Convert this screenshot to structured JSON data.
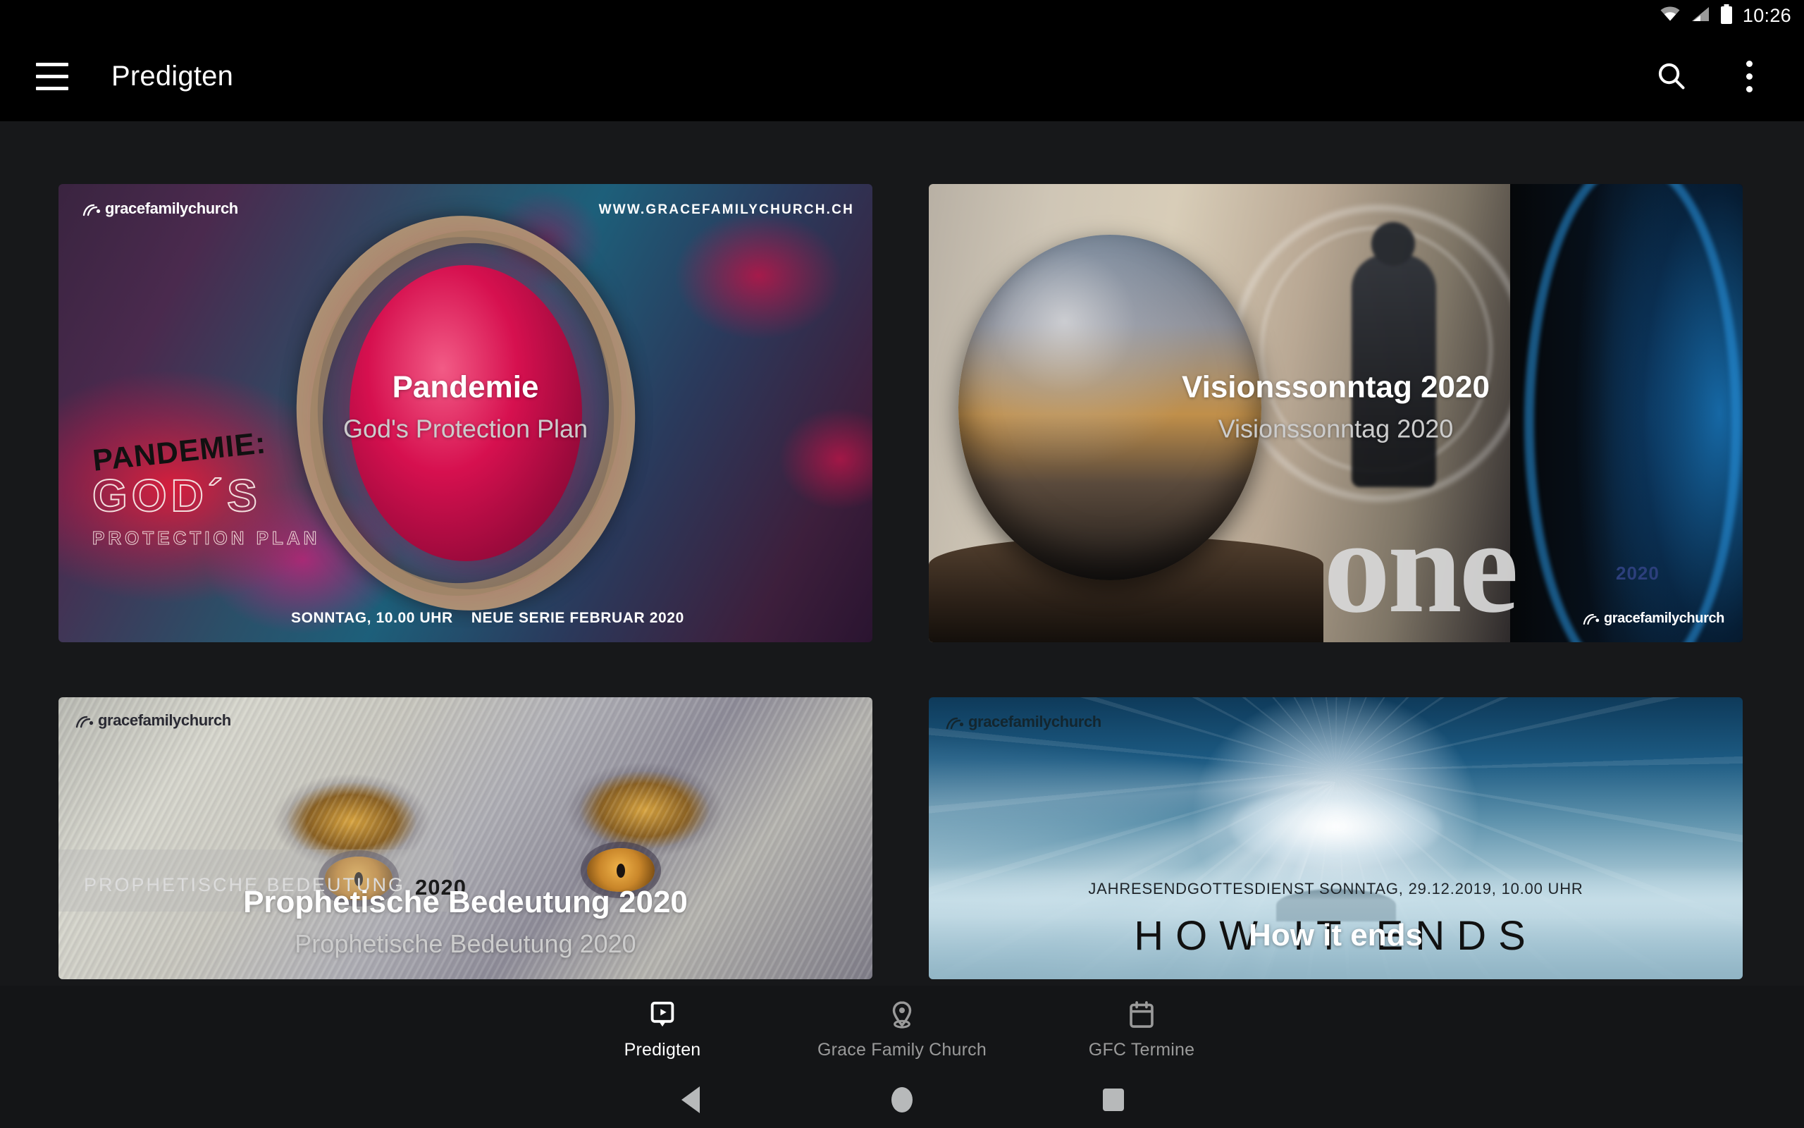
{
  "statusbar": {
    "time": "10:26",
    "icons": [
      "wifi-icon",
      "cellular-signal-icon",
      "battery-icon"
    ]
  },
  "appbar": {
    "title": "Predigten",
    "menu_icon": "hamburger-menu-icon",
    "search_icon": "search-icon",
    "overflow_icon": "overflow-menu-icon"
  },
  "sermons": [
    {
      "title": "Pandemie",
      "subtitle": "God's Protection Plan",
      "artwork": {
        "brand": "gracefamilychurch",
        "url": "WWW.GRACEFAMILYCHURCH.CH",
        "headline_1": "PANDEMIE:",
        "headline_2": "GOD´S",
        "headline_3": "PROTECTION PLAN",
        "footer_left": "SONNTAG, 10.00 UHR",
        "footer_right": "NEUE SERIE FEBRUAR 2020"
      }
    },
    {
      "title": "Visionssonntag 2020",
      "subtitle": "Visionssonntag 2020",
      "artwork": {
        "brand": "gracefamilychurch",
        "wordmark": "one",
        "year": "2020"
      }
    },
    {
      "title": "Prophetische Bedeutung 2020",
      "subtitle": "Prophetische Bedeutung 2020",
      "artwork": {
        "brand": "gracefamilychurch",
        "caption": "PROPHETISCHE BEDEUTUNG",
        "year": "2020"
      }
    },
    {
      "title": "How it ends",
      "subtitle": "",
      "artwork": {
        "brand": "gracefamilychurch",
        "date_line": "JAHRESENDGOTTESDIENST SONNTAG, 29.12.2019, 10.00 UHR",
        "headline": "HOW IT ENDS"
      }
    }
  ],
  "tabbar": {
    "items": [
      {
        "label": "Predigten",
        "icon": "video-presentation-icon",
        "active": true
      },
      {
        "label": "Grace Family Church",
        "icon": "location-pin-icon",
        "active": false
      },
      {
        "label": "GFC Termine",
        "icon": "calendar-icon",
        "active": false
      }
    ]
  },
  "sysnav": {
    "back": "back-triangle-icon",
    "home": "home-circle-icon",
    "recents": "recents-square-icon"
  },
  "colors": {
    "appbar_bg": "#000000",
    "content_bg": "#17181a",
    "tabbar_bg": "#141517",
    "active_label": "#ffffff",
    "inactive_label": "#9a9a9a"
  }
}
